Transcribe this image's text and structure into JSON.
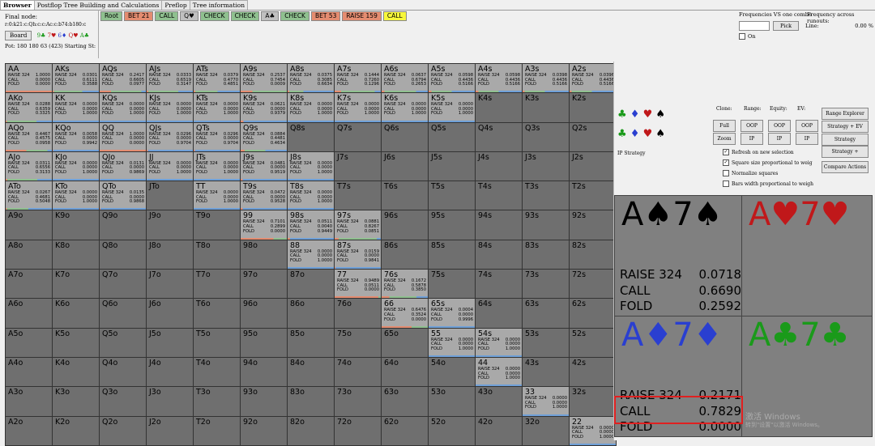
{
  "tabs": [
    "Browser",
    "Postflop Tree Building and Calculations",
    "Preflop",
    "Tree information"
  ],
  "info": {
    "final_nodes_label": "Final node:",
    "board_line": "r:0:k21:c:Qh:c:c:Ac:c:b74:b180:c",
    "board_button": "Board",
    "board_cards": [
      "9♣",
      "7♥",
      "6♦",
      "Q♥",
      "A♣"
    ],
    "pot_line": "Pot: 180 180 63 (423) Starting St:"
  },
  "nodes": [
    {
      "label": "Root",
      "color": "#8fc08f"
    },
    {
      "label": "BET 21",
      "color": "#e48c70"
    },
    {
      "label": "CALL",
      "color": "#8fc08f"
    },
    {
      "label": "Q♥",
      "color": "#c0c0c0"
    },
    {
      "label": "CHECK",
      "color": "#8fc08f"
    },
    {
      "label": "CHECK",
      "color": "#8fc08f"
    },
    {
      "label": "A♣",
      "color": "#c0c0c0"
    },
    {
      "label": "CHECK",
      "color": "#8fc08f"
    },
    {
      "label": "BET 53",
      "color": "#e48c70"
    },
    {
      "label": "RAISE 159",
      "color": "#e48c70"
    },
    {
      "label": "CALL",
      "color": "#f7f73a"
    }
  ],
  "freq": {
    "title": "Frequencies VS one combo",
    "runouts": "Frequency across runouts:",
    "pick": "Pick",
    "line": "Line:",
    "pct": "0.00 %",
    "on": "On"
  },
  "grid": [
    [
      "AA|RAISE 324 1.0000|CALL 0.0000|FOLD 0.0000|L",
      "AKs|RAISE 324 0.0301|CALL 0.6111|FOLD 0.3588|L",
      "AQs|RAISE 324 0.2417|CALL 0.6605|FOLD 0.0977|L",
      "AJs|RAISE 324 0.0333|CALL 0.6519|FOLD 0.3147|L",
      "ATs|RAISE 324 0.0379|CALL 0.4770|FOLD 0.4851|L",
      "A9s|RAISE 324 0.2537|CALL 0.7454|FOLD 0.0009|L",
      "A8s|RAISE 324 0.0375|CALL 0.3085|FOLD 0.6634|L",
      "A7s|RAISE 324 0.1444|CALL 0.7260|FOLD 0.1296|L",
      "A6s|RAISE 324 0.0637|CALL 0.6794|FOLD 0.2653|L",
      "A5s|RAISE 324 0.0598|CALL 0.4436|FOLD 0.5166|L",
      "A4s|RAISE 324 0.0598|CALL 0.4436|FOLD 0.5166|L",
      "A3s|RAISE 324 0.0398|CALL 0.4436|FOLD 0.5166|L",
      "A2s|RAISE 324 0.0396|CALL 0.4436|FOLD 0.5166|L"
    ],
    [
      "AKo|RAISE 324 0.0288|CALL 0.6359|FOLD 0.3325|L",
      "KK|RAISE 324 0.0000|CALL 0.0000|FOLD 1.0000|L",
      "KQs|RAISE 324 0.0000|CALL 0.0000|FOLD 1.0000|L",
      "KJs|RAISE 324 0.0000|CALL 0.0000|FOLD 1.0000|L",
      "KTs|RAISE 324 0.0000|CALL 0.0000|FOLD 1.0000|L",
      "K9s|RAISE 324 0.0621|CALL 0.0000|FOLD 0.9379|L",
      "K8s|RAISE 324 0.0000|CALL 0.0000|FOLD 1.0000|L",
      "K7s|RAISE 324 0.0000|CALL 0.0000|FOLD 1.0000|L",
      "K6s|RAISE 324 0.0000|CALL 0.0000|FOLD 1.0000|L",
      "K5s|RAISE 324 0.0000|CALL 0.0000|FOLD 1.0000|L",
      "K4s||||D",
      "K3s||||D",
      "K2s||||D"
    ],
    [
      "AQo|RAISE 324 0.4467|CALL 0.4575|FOLD 0.0958|L",
      "KQo|RAISE 324 0.0058|CALL 0.0000|FOLD 0.9942|L",
      "QQ|RAISE 324 1.0000|CALL 0.0000|FOLD 0.0000|L",
      "QJs|RAISE 324 0.0296|CALL 0.0000|FOLD 0.9704|L",
      "QTs|RAISE 324 0.0296|CALL 0.0000|FOLD 0.9704|L",
      "Q9s|RAISE 324 0.0884|CALL 0.4481|FOLD 0.4634|L",
      "Q8s||||D",
      "Q7s||||D",
      "Q6s||||D",
      "Q5s||||D",
      "Q4s||||D",
      "Q3s||||D",
      "Q2s||||D"
    ],
    [
      "AJo|RAISE 324 0.0311|CALL 0.6556|FOLD 0.3133|L",
      "KJo|RAISE 324 0.0000|CALL 0.0000|FOLD 1.0000|L",
      "QJo|RAISE 324 0.0131|CALL 0.0000|FOLD 0.9869|L",
      "JJ|RAISE 324 0.0000|CALL 0.0000|FOLD 1.0000|L",
      "JTs|RAISE 324 0.0000|CALL 0.0000|FOLD 1.0000|L",
      "J9s|RAISE 324 0.0481|CALL 0.0000|FOLD 0.9519|L",
      "J8s|RAISE 324 0.0000|CALL 0.0000|FOLD 1.0000|L",
      "J7s||||D",
      "J6s||||D",
      "J5s||||D",
      "J4s||||D",
      "J3s||||D",
      "J2s||||D"
    ],
    [
      "ATo|RAISE 324 0.0267|CALL 0.4681|FOLD 0.5048|L",
      "KTo|RAISE 324 0.0000|CALL 0.0000|FOLD 1.0000|L",
      "QTo|RAISE 324 0.0135|CALL 0.0000|FOLD 0.9868|L",
      "JTo||||D",
      "TT|RAISE 324 0.0000|CALL 0.0000|FOLD 1.0000|L",
      "T9s|RAISE 324 0.0472|CALL 0.0000|FOLD 0.9528|L",
      "T8s|RAISE 324 0.0000|CALL 0.0000|FOLD 1.0000|L",
      "T7s||||D",
      "T6s||||D",
      "T5s||||D",
      "T4s||||D",
      "T3s||||D",
      "T2s||||D"
    ],
    [
      "A9o||||D",
      "K9o||||D",
      "Q9o||||D",
      "J9o||||D",
      "T9o||||D",
      "99|RAISE 324 0.7101|CALL 0.2899|FOLD 0.0000|L",
      "98s|RAISE 324 0.0511|CALL 0.0040|FOLD 0.9449|L",
      "97s|RAISE 324 0.0881|CALL 0.8267|FOLD 0.0851|L",
      "96s||||D",
      "95s||||D",
      "94s||||D",
      "93s||||D",
      "92s||||D"
    ],
    [
      "A8o||||D",
      "K8o||||D",
      "Q8o||||D",
      "J8o||||D",
      "T8o||||D",
      "98o||||D",
      "88|RAISE 324 0.0000|CALL 0.0000|FOLD 1.0000|L",
      "87s|RAISE 324 0.0159|CALL 0.0000|FOLD 0.9841|L",
      "86s||||D",
      "85s||||D",
      "84s||||D",
      "83s||||D",
      "82s||||D"
    ],
    [
      "A7o||||D",
      "K7o||||D",
      "Q7o||||D",
      "J7o||||D",
      "T7o||||D",
      "97o||||D",
      "87o||||D",
      "77|RAISE 324 0.9489|CALL 0.0511|FOLD 0.0000|L",
      "76s|RAISE 324 0.1672|CALL 0.5878|FOLD 0.3850|L",
      "75s||||D",
      "74s||||D",
      "73s||||D",
      "72s||||D"
    ],
    [
      "A6o||||D",
      "K6o||||D",
      "Q6o||||D",
      "J6o||||D",
      "T6o||||D",
      "96o||||D",
      "86o||||D",
      "76o||||D",
      "66|RAISE 324 0.6476|CALL 0.3524|FOLD 0.0000|L",
      "65s|RAISE 324 0.0004|CALL 0.0000|FOLD 0.9996|L",
      "64s||||D",
      "63s||||D",
      "62s||||D"
    ],
    [
      "A5o||||D",
      "K5o||||D",
      "Q5o||||D",
      "J5o||||D",
      "T5o||||D",
      "95o||||D",
      "85o||||D",
      "75o||||D",
      "65o||||D",
      "55|RAISE 324 0.0000|CALL 0.0000|FOLD 1.0000|L",
      "54s|RAISE 324 0.0000|CALL 0.0000|FOLD 1.0000|L",
      "53s||||D",
      "52s||||D"
    ],
    [
      "A4o||||D",
      "K4o||||D",
      "Q4o||||D",
      "J4o||||D",
      "T4o||||D",
      "94o||||D",
      "84o||||D",
      "74o||||D",
      "64o||||D",
      "54o||||D",
      "44|RAISE 324 0.0000|CALL 0.0000|FOLD 1.0000|L",
      "43s||||D",
      "42s||||D"
    ],
    [
      "A3o||||D",
      "K3o||||D",
      "Q3o||||D",
      "J3o||||D",
      "T3o||||D",
      "93o||||D",
      "83o||||D",
      "73o||||D",
      "63o||||D",
      "53o||||D",
      "43o||||D",
      "33|RAISE 324 0.0000|CALL 0.0000|FOLD 1.0000|L",
      "32s||||D"
    ],
    [
      "A2o||||D",
      "K2o||||D",
      "Q2o||||D",
      "J2o||||D",
      "T2o||||D",
      "92o||||D",
      "82o||||D",
      "72o||||D",
      "62o||||D",
      "52o||||D",
      "42o||||D",
      "32o||||D",
      "22|RAISE 324 0.0000|CALL 0.0000|FOLD 1.0000|L"
    ]
  ],
  "right": {
    "labels": {
      "clone": "Clone:",
      "range": "Range:",
      "equity": "Equity:",
      "ev": "EV:"
    },
    "buttons": {
      "full": "Full",
      "zoom": "Zoom",
      "oop1": "OOP",
      "ip1": "IP",
      "oop2": "OOP",
      "ip2": "IP",
      "oop3": "OOP",
      "ip3": "IP",
      "range_explorer": "Range Explorer",
      "strategy_ev": "Strategy + EV",
      "strategy": "Strategy",
      "strategy_plus": "Strategy +",
      "compare": "Compare Actions"
    },
    "ip_strategy": "IP Strategy",
    "checks": [
      {
        "label": "Refresh on new selection",
        "checked": true
      },
      {
        "label": "Square size proportional to weig",
        "checked": true
      },
      {
        "label": "Normalize squares",
        "checked": false
      },
      {
        "label": "Bars width proportional to weigh",
        "checked": false
      }
    ],
    "combos": [
      {
        "hand": "A♠7♠",
        "color": "#000000",
        "lines": [
          [
            "RAISE 324",
            "0.0718"
          ],
          [
            "CALL",
            "0.6690"
          ],
          [
            "FOLD",
            "0.2592"
          ]
        ]
      },
      {
        "hand": "A♥7♥",
        "color": "#c0181a",
        "lines": []
      },
      {
        "hand": "A♦7♦",
        "color": "#2a3fd0",
        "lines": [
          [
            "RAISE 324",
            "0.2171"
          ],
          [
            "CALL",
            "0.7829"
          ],
          [
            "FOLD",
            "0.0000"
          ]
        ]
      },
      {
        "hand": "A♣7♣",
        "color": "#1a9a1a",
        "lines": []
      }
    ]
  },
  "watermark": {
    "line1": "激活 Windows",
    "line2": "转到\"设置\"以激活 Windows。"
  }
}
